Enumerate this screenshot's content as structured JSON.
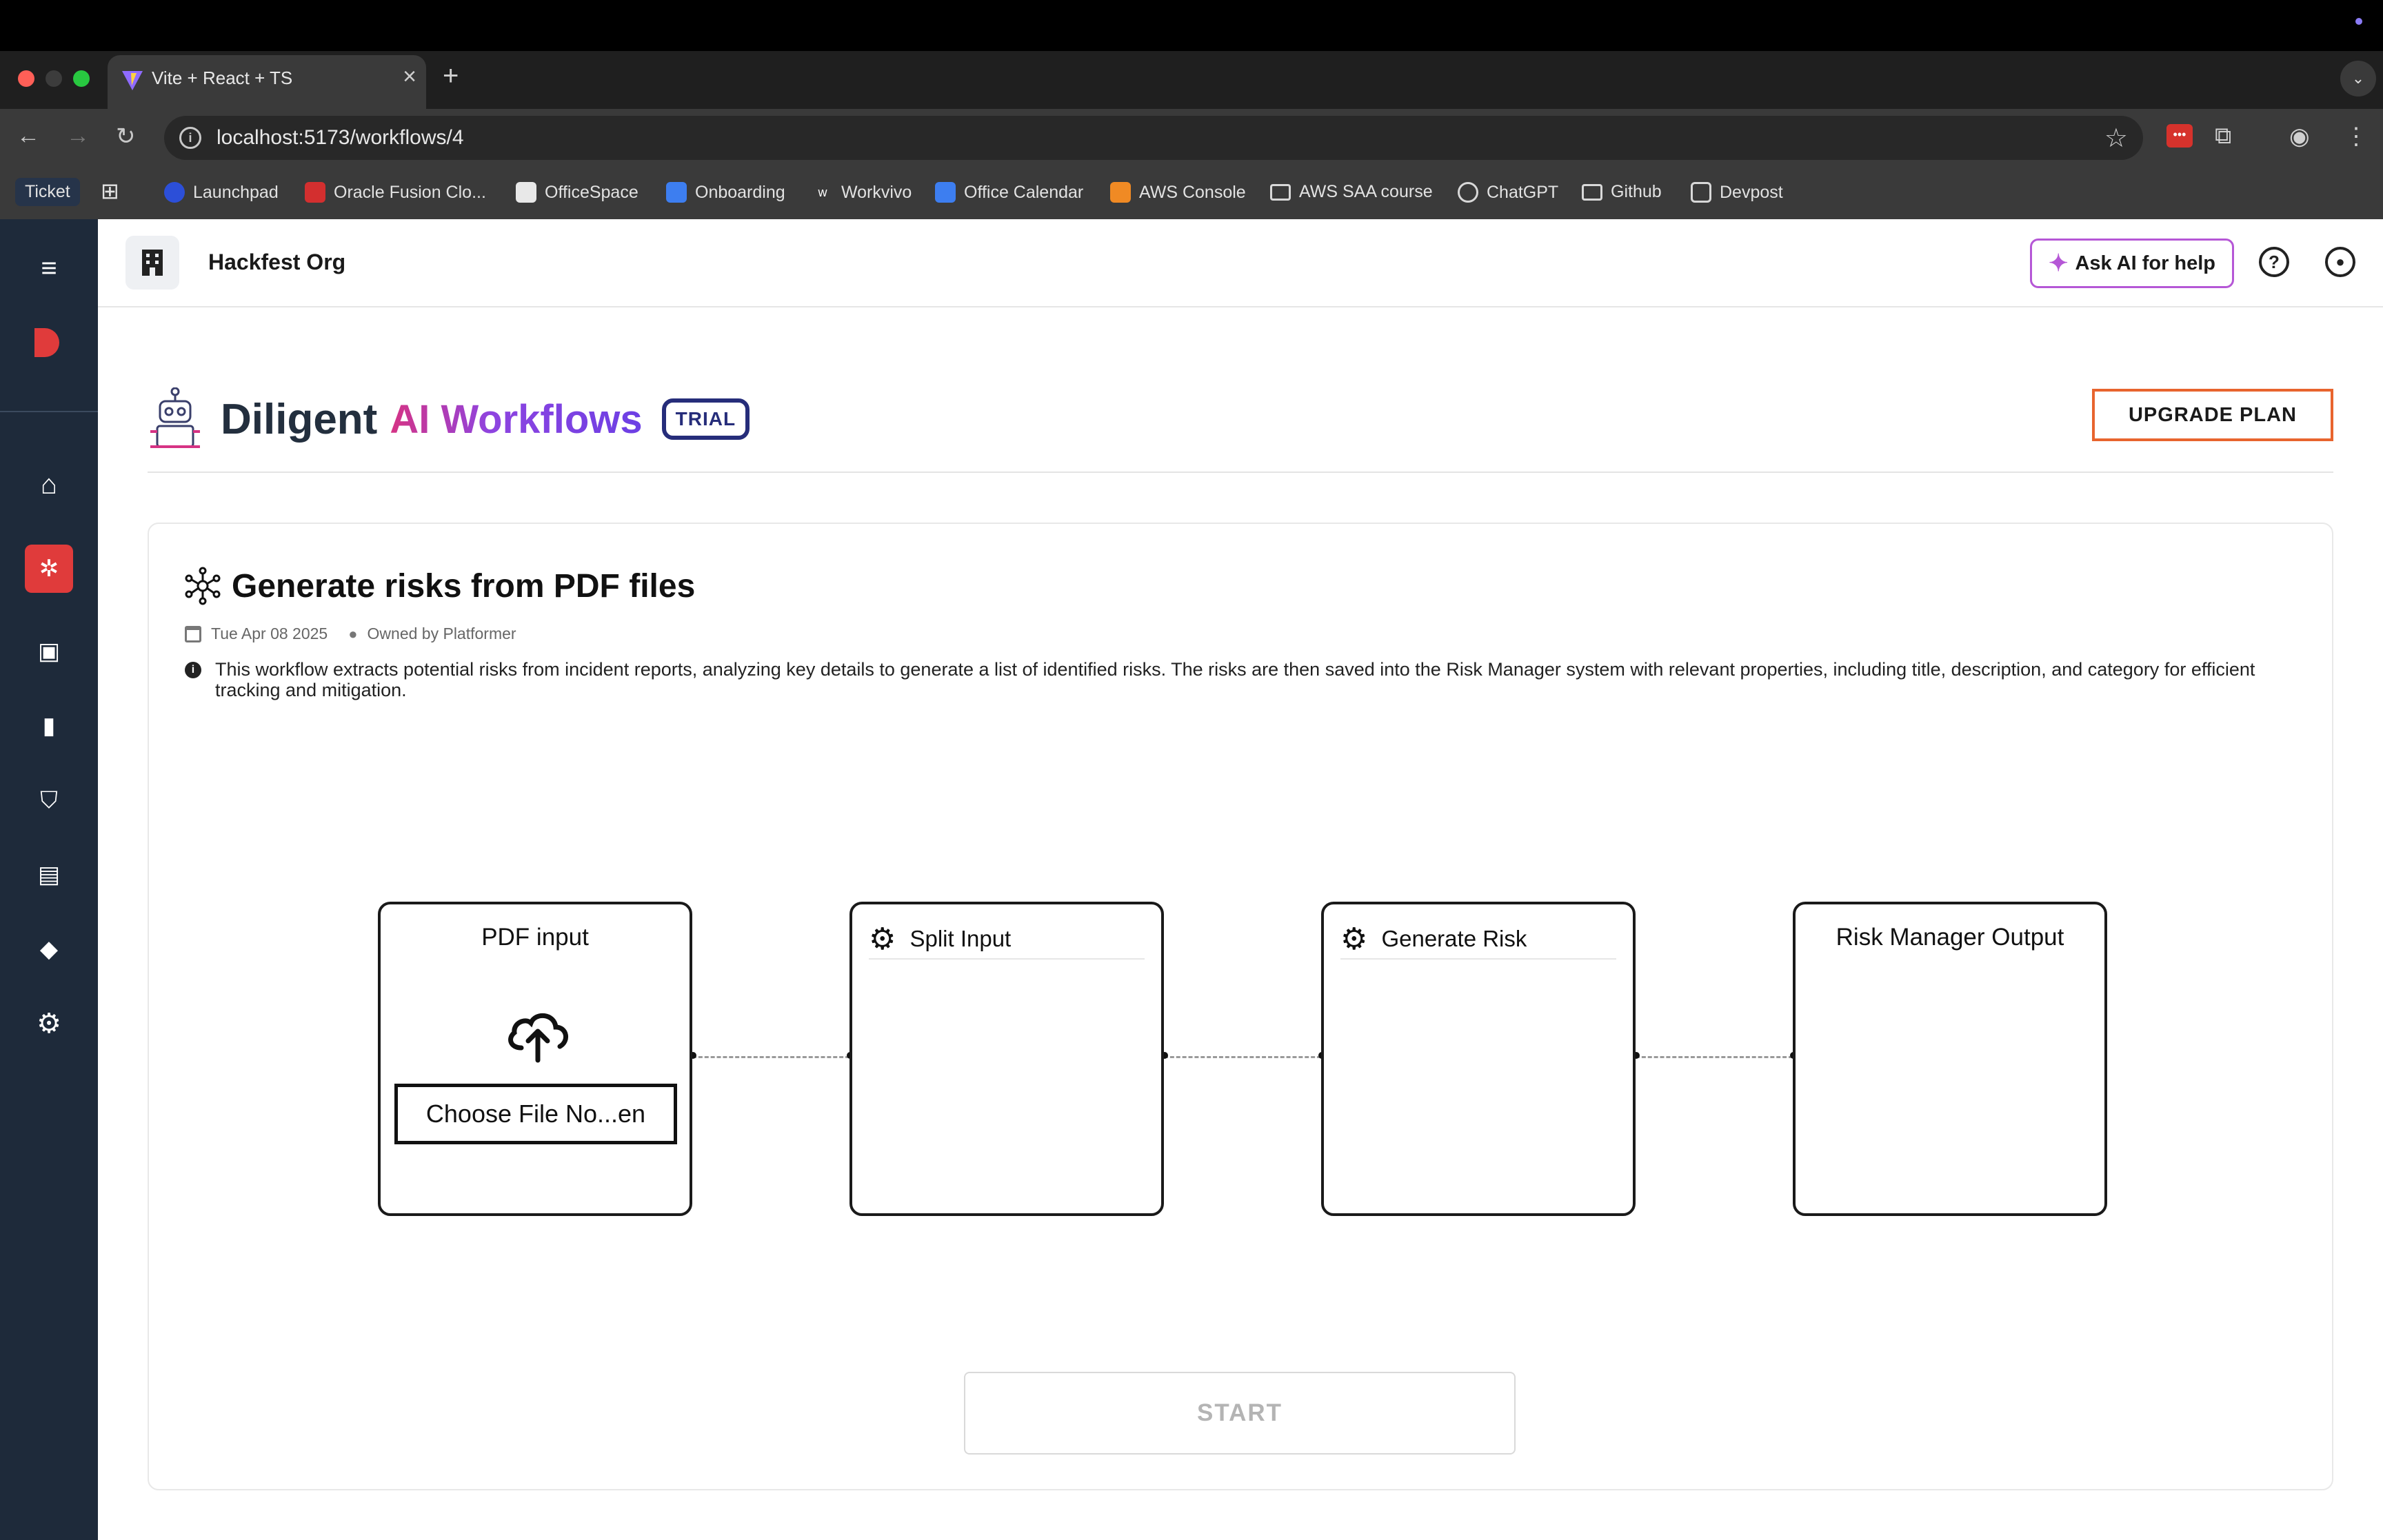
{
  "browser": {
    "tab_title": "Vite + React + TS",
    "tab_close": "×",
    "new_tab": "+",
    "url": "localhost:5173/workflows/4",
    "bookmarks": [
      {
        "label": "Ticket",
        "icon": "ticket-icon"
      },
      {
        "label": "",
        "icon": "apps-grid-icon"
      },
      {
        "label": "Launchpad",
        "icon": "launchpad-icon"
      },
      {
        "label": "Oracle Fusion Clo...",
        "icon": "oracle-icon"
      },
      {
        "label": "OfficeSpace",
        "icon": "officespace-icon"
      },
      {
        "label": "Onboarding",
        "icon": "onboarding-icon"
      },
      {
        "label": "Workvivo",
        "icon": "workvivo-icon"
      },
      {
        "label": "Office Calendar",
        "icon": "calendar-icon"
      },
      {
        "label": "AWS Console",
        "icon": "aws-icon"
      },
      {
        "label": "AWS SAA course",
        "icon": "folder-icon"
      },
      {
        "label": "ChatGPT",
        "icon": "chatgpt-icon"
      },
      {
        "label": "Github",
        "icon": "folder-icon"
      },
      {
        "label": "Devpost",
        "icon": "devpost-icon"
      }
    ]
  },
  "header": {
    "org_name": "Hackfest Org",
    "ask_ai_label": "Ask AI for help"
  },
  "brand": {
    "name": "Diligent",
    "product": "AI Workflows",
    "badge": "TRIAL",
    "upgrade_label": "UPGRADE PLAN"
  },
  "workflow": {
    "title": "Generate risks from PDF files",
    "date": "Tue Apr 08 2025",
    "owner": "Owned by Platformer",
    "description": "This workflow extracts potential risks from incident reports, analyzing key details to generate a list of identified risks. The risks are then saved into the Risk Manager system with relevant properties, including title, description, and category for efficient tracking and mitigation.",
    "nodes": [
      {
        "title": "PDF input",
        "file_button": "Choose File No...en"
      },
      {
        "title": "Split Input"
      },
      {
        "title": "Generate Risk"
      },
      {
        "title": "Risk Manager Output"
      }
    ],
    "start_label": "START"
  },
  "colors": {
    "sidebar": "#1e2a3a",
    "active_nav": "#e03b3b",
    "upgrade_border": "#e8642e",
    "ask_ai_border": "#b557d6",
    "trial_badge": "#262d7a"
  }
}
